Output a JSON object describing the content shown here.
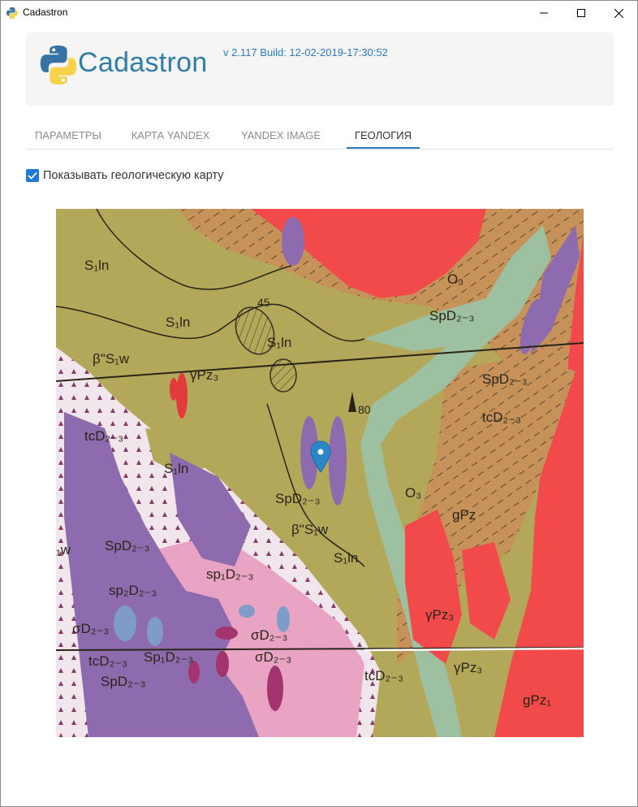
{
  "window": {
    "title": "Cadastron",
    "controls": [
      "minimize-icon",
      "maximize-icon",
      "close-icon"
    ]
  },
  "header": {
    "brand": "Cadastron",
    "version": "v 2.117 Build: 12-02-2019-17:30:52"
  },
  "tabs": [
    {
      "label": "ПАРАМЕТРЫ",
      "active": false
    },
    {
      "label": "КАРТА YANDEX",
      "active": false
    },
    {
      "label": "YANDEX IMAGE",
      "active": false
    },
    {
      "label": "ГЕОЛОГИЯ",
      "active": true
    }
  ],
  "geology": {
    "show_map_label": "Показывать геологическую карту",
    "show_map_checked": true
  },
  "map_labels": {
    "s1ln_a": "S₁ln",
    "s1ln_b": "S₁ln",
    "s1ln_c": "S₁ln",
    "s1ln_d": "S₁ln",
    "s1ln_e": "S₁ln",
    "dip45": "45",
    "dip80": "80",
    "beta_s1w_a": "β\"S₁w",
    "beta_s1w_b": "β\"S₁w",
    "gpz3_a": "γPz₃",
    "gpz3_b": "γPz₃",
    "gpz3_c": "γPz₃",
    "o3_a": "O₃",
    "o3_b": "O₃",
    "spd_a": "SpD₂₋₃",
    "spd_b": "SpD₂₋₃",
    "spd_c": "SpD₂₋₃",
    "spd_d": "SpD₂₋₃",
    "spd_e": "SpD₂₋₃",
    "tcd_a": "tcD₂₋₃",
    "tcd_b": "tcD₂₋₃",
    "tcd_c": "tcD₂₋₃",
    "tcd_d": "tcD₂₋₃",
    "sp2d": "sp₂D₂₋₃",
    "sp1d": "sp₁D₂₋₃",
    "sd_a": "σD₂₋₃",
    "sd_b": "σD₂₋₃",
    "sd_c": "σD₂₋₃",
    "spd_small": "Sp₁D₂₋₃",
    "gpz_a": "gPz",
    "gpz_b": "gPz₁",
    "spd_right": "SpD₂₋₃",
    "w_left": "₁w"
  },
  "colors": {
    "accent": "#1e78d6",
    "brand": "#2f7da8",
    "map_olive": "#b3a85a",
    "map_red": "#f24a4a",
    "map_brown": "#c7915a",
    "map_pink": "#e9a4c4",
    "map_purple": "#8e6bae",
    "map_green": "#9cc0a0",
    "marker": "#2b86c5"
  }
}
